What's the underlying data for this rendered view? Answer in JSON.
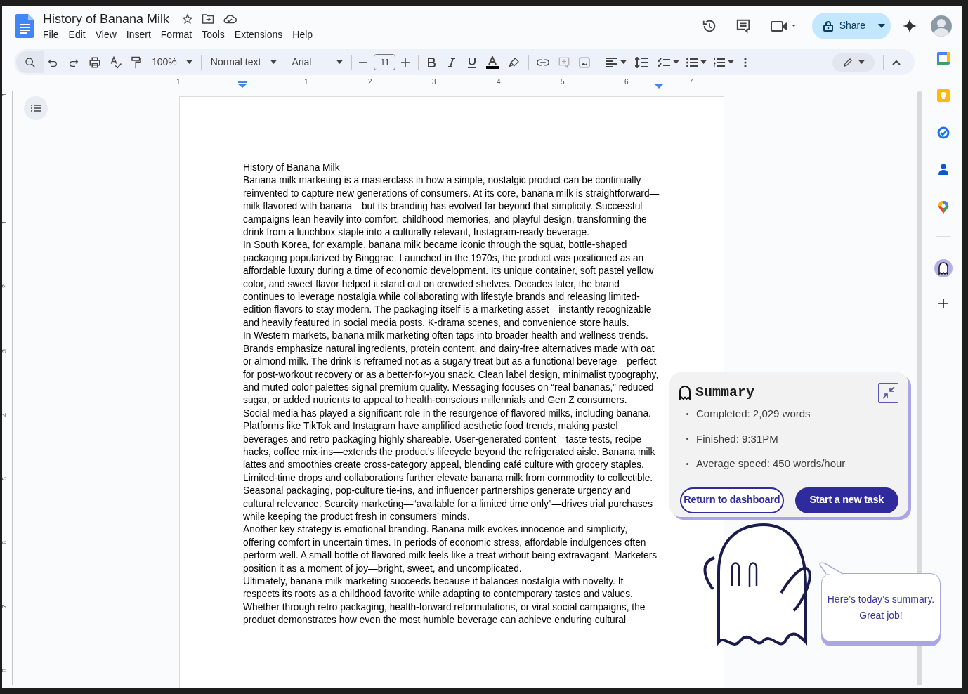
{
  "doc_title": "History of Banana Milk",
  "menu": [
    "File",
    "Edit",
    "View",
    "Insert",
    "Format",
    "Tools",
    "Extensions",
    "Help"
  ],
  "share": {
    "label": "Share"
  },
  "toolbar": {
    "zoom": "100%",
    "style": "Normal text",
    "font": "Arial",
    "font_size": "11"
  },
  "ruler": {
    "marks": [
      "1",
      "1",
      "2",
      "3",
      "4",
      "5",
      "6",
      "7"
    ]
  },
  "vertical_ruler": {
    "marks": [
      "1",
      "1",
      "2",
      "3",
      "4",
      "5",
      "6",
      "7",
      "8"
    ]
  },
  "document": {
    "paragraphs": [
      "History of Banana Milk",
      "Banana milk marketing is a masterclass in how a simple, nostalgic product can be continually reinvented to capture new generations of consumers. At its core, banana milk is straightforward—milk flavored with banana—but its branding has evolved far beyond that simplicity. Successful campaigns lean heavily into comfort, childhood memories, and playful design, transforming the drink from a lunchbox staple into a culturally relevant, Instagram-ready beverage.",
      "In South Korea, for example, banana milk became iconic through the squat, bottle-shaped packaging popularized by Binggrae. Launched in the 1970s, the product was positioned as an affordable luxury during a time of economic development. Its unique container, soft pastel yellow color, and sweet flavor helped it stand out on crowded shelves. Decades later, the brand continues to leverage nostalgia while collaborating with lifestyle brands and releasing limited-edition flavors to stay modern. The packaging itself is a marketing asset—instantly recognizable and heavily featured in social media posts, K-drama scenes, and convenience store hauls.",
      "In Western markets, banana milk marketing often taps into broader health and wellness trends. Brands emphasize natural ingredients, protein content, and dairy-free alternatives made with oat or almond milk. The drink is reframed not as a sugary treat but as a functional beverage—perfect for post-workout recovery or as a better-for-you snack. Clean label design, minimalist typography, and muted color palettes signal premium quality. Messaging focuses on “real bananas,” reduced sugar, or added nutrients to appeal to health-conscious millennials and Gen Z consumers.",
      "Social media has played a significant role in the resurgence of flavored milks, including banana. Platforms like TikTok and Instagram have amplified aesthetic food trends, making pastel beverages and retro packaging highly shareable. User-generated content—taste tests, recipe hacks, coffee mix-ins—extends the product’s lifecycle beyond the refrigerated aisle. Banana milk lattes and smoothies create cross-category appeal, blending café culture with grocery staples.",
      "Limited-time drops and collaborations further elevate banana milk from commodity to collectible. Seasonal packaging, pop-culture tie-ins, and influencer partnerships generate urgency and cultural relevance. Scarcity marketing—“available for a limited time only”—drives trial purchases while keeping the product fresh in consumers’ minds.",
      "Another key strategy is emotional branding. Banana milk evokes innocence and simplicity, offering comfort in uncertain times. In periods of economic stress, affordable indulgences often perform well. A small bottle of flavored milk feels like a treat without being extravagant. Marketers position it as a moment of joy—bright, sweet, and uncomplicated.",
      "Ultimately, banana milk marketing succeeds because it balances nostalgia with novelty. It respects its roots as a childhood favorite while adapting to contemporary tastes and values. Whether through retro packaging, health-forward reformulations, or viral social campaigns, the product demonstrates how even the most humble beverage can achieve enduring cultural"
    ]
  },
  "summary": {
    "title": "Summary",
    "items": [
      "Completed: 2,029 words",
      "Finished: 9:31PM",
      "Average speed: 450 words/hour"
    ],
    "buttons": [
      {
        "label": "Return to dashboard",
        "kind": "outline"
      },
      {
        "label": "Start a new task",
        "kind": "filled"
      }
    ]
  },
  "speech_bubble": {
    "lines": [
      "Here’s today’s summary.",
      "Great job!"
    ]
  }
}
